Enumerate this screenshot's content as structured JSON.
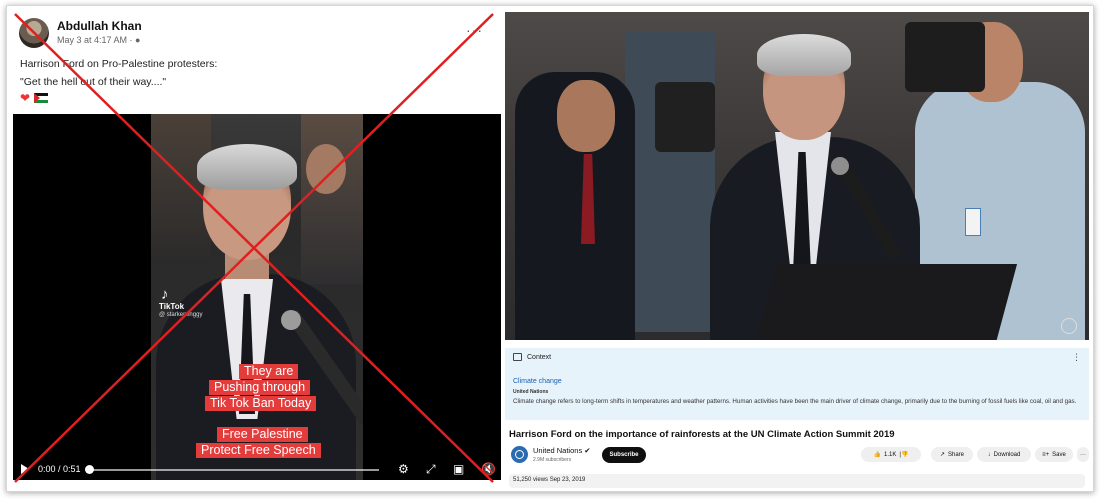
{
  "post": {
    "author": "Abdullah Khan",
    "date": "May 3 at 4:17 AM · ●",
    "menu_icon": "more-dots-icon",
    "text_line1": "Harrison Ford on Pro-Palestine protesters:",
    "text_line2": "\"Get the hell out of their way....\"",
    "reactions": [
      "heart-icon",
      "palestine-flag-icon"
    ]
  },
  "fb_video": {
    "watermark_brand": "TikTok",
    "watermark_user": "@ starkenfinggy",
    "captions": [
      "They are",
      "Pushing through",
      "Tik Tok Ban Today",
      "Free Palestine",
      "Protect Free Speech"
    ],
    "time": "0:00 / 0:51",
    "progress": 0.0,
    "icons": [
      "play-icon",
      "settings-gear-icon",
      "expand-icon",
      "picture-in-picture-icon",
      "mute-icon"
    ]
  },
  "overlay": {
    "marker": "red-cross-out-mark",
    "color": "#e02020"
  },
  "youtube": {
    "context": {
      "label": "Context",
      "topic": "Climate change",
      "source": "United Nations",
      "body": "Climate change refers to long-term shifts in temperatures and weather patterns. Human activities have been the main driver of climate change, primarily due to the burning of fossil fuels like coal, oil and gas."
    },
    "title": "Harrison Ford on the importance of rainforests at the UN Climate Action Summit 2019",
    "channel": "United Nations ✔",
    "subscribers": "2.9M subscribers",
    "subscribe_label": "Subscribe",
    "likes": "1.1K",
    "share_label": "Share",
    "download_label": "Download",
    "save_label": "Save",
    "stats": "51,250 views  Sep 23, 2019",
    "colors": {
      "context_bg": "#e6f3fb",
      "link": "#1a5fb4",
      "subscribe_bg": "#0f0f0f"
    }
  }
}
